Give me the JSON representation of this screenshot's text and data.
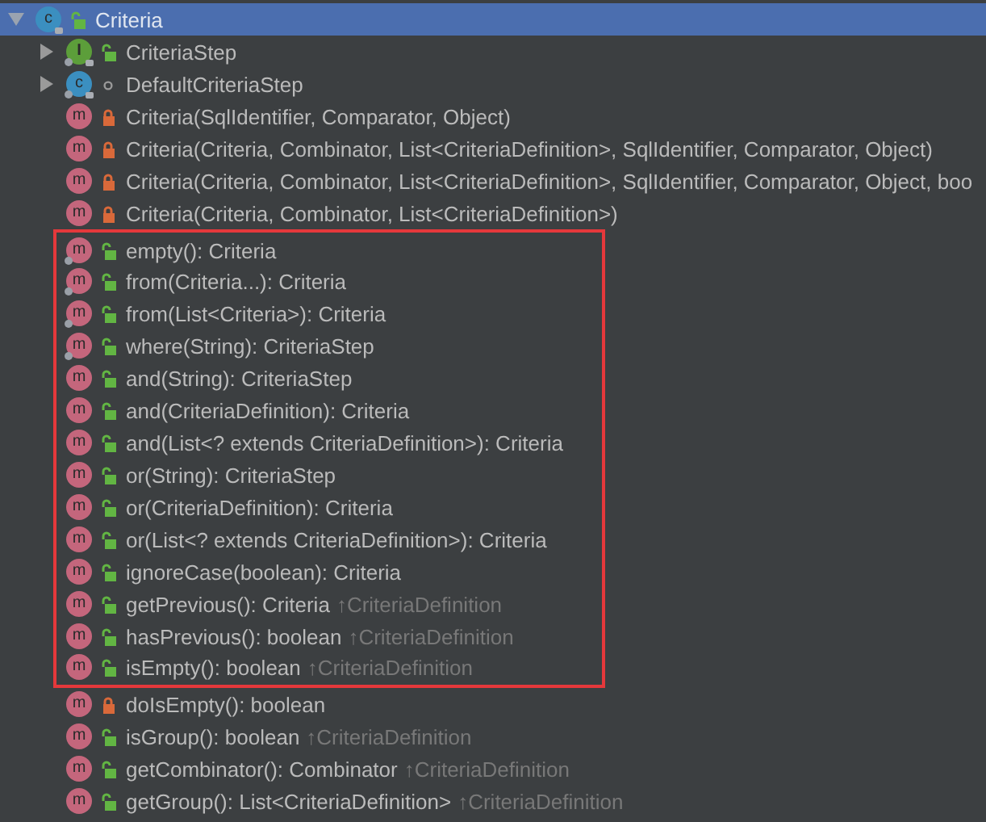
{
  "tree": {
    "label": "Criteria",
    "icon_letter": "c",
    "kind": "class",
    "private": false,
    "package": false,
    "static": false,
    "final": true,
    "expanded": true,
    "selected": true,
    "children": [
      {
        "label": "CriteriaStep",
        "icon_letter": "I",
        "kind": "interface",
        "private": false,
        "package": false,
        "static": true,
        "final": true,
        "expanded": false,
        "highlighted": false
      },
      {
        "label": "DefaultCriteriaStep",
        "icon_letter": "c",
        "kind": "class",
        "private": false,
        "package": true,
        "static": true,
        "final": true,
        "expanded": false,
        "highlighted": false
      },
      {
        "label": "Criteria(SqlIdentifier, Comparator, Object)",
        "icon_letter": "m",
        "kind": "method",
        "private": true,
        "package": false,
        "static": false,
        "highlighted": false
      },
      {
        "label": "Criteria(Criteria, Combinator, List<CriteriaDefinition>, SqlIdentifier, Comparator, Object)",
        "icon_letter": "m",
        "kind": "method",
        "private": true,
        "package": false,
        "static": false,
        "highlighted": false
      },
      {
        "label": "Criteria(Criteria, Combinator, List<CriteriaDefinition>, SqlIdentifier, Comparator, Object, boo",
        "icon_letter": "m",
        "kind": "method",
        "private": true,
        "package": false,
        "static": false,
        "highlighted": false
      },
      {
        "label": "Criteria(Criteria, Combinator, List<CriteriaDefinition>)",
        "icon_letter": "m",
        "kind": "method",
        "private": true,
        "package": false,
        "static": false,
        "highlighted": false
      },
      {
        "label": "empty(): Criteria",
        "icon_letter": "m",
        "kind": "method",
        "private": false,
        "package": false,
        "static": true,
        "highlighted": true
      },
      {
        "label": "from(Criteria...): Criteria",
        "icon_letter": "m",
        "kind": "method",
        "private": false,
        "package": false,
        "static": true,
        "highlighted": true
      },
      {
        "label": "from(List<Criteria>): Criteria",
        "icon_letter": "m",
        "kind": "method",
        "private": false,
        "package": false,
        "static": true,
        "highlighted": true
      },
      {
        "label": "where(String): CriteriaStep",
        "icon_letter": "m",
        "kind": "method",
        "private": false,
        "package": false,
        "static": true,
        "highlighted": true
      },
      {
        "label": "and(String): CriteriaStep",
        "icon_letter": "m",
        "kind": "method",
        "private": false,
        "package": false,
        "static": false,
        "highlighted": true
      },
      {
        "label": "and(CriteriaDefinition): Criteria",
        "icon_letter": "m",
        "kind": "method",
        "private": false,
        "package": false,
        "static": false,
        "highlighted": true
      },
      {
        "label": "and(List<? extends CriteriaDefinition>): Criteria",
        "icon_letter": "m",
        "kind": "method",
        "private": false,
        "package": false,
        "static": false,
        "highlighted": true
      },
      {
        "label": "or(String): CriteriaStep",
        "icon_letter": "m",
        "kind": "method",
        "private": false,
        "package": false,
        "static": false,
        "highlighted": true
      },
      {
        "label": "or(CriteriaDefinition): Criteria",
        "icon_letter": "m",
        "kind": "method",
        "private": false,
        "package": false,
        "static": false,
        "highlighted": true
      },
      {
        "label": "or(List<? extends CriteriaDefinition>): Criteria",
        "icon_letter": "m",
        "kind": "method",
        "private": false,
        "package": false,
        "static": false,
        "highlighted": true
      },
      {
        "label": "ignoreCase(boolean): Criteria",
        "icon_letter": "m",
        "kind": "method",
        "private": false,
        "package": false,
        "static": false,
        "highlighted": true
      },
      {
        "label": "getPrevious(): Criteria",
        "inherited": "↑CriteriaDefinition",
        "icon_letter": "m",
        "kind": "method",
        "private": false,
        "package": false,
        "static": false,
        "highlighted": true
      },
      {
        "label": "hasPrevious(): boolean",
        "inherited": "↑CriteriaDefinition",
        "icon_letter": "m",
        "kind": "method",
        "private": false,
        "package": false,
        "static": false,
        "highlighted": true
      },
      {
        "label": "isEmpty(): boolean",
        "inherited": "↑CriteriaDefinition",
        "icon_letter": "m",
        "kind": "method",
        "private": false,
        "package": false,
        "static": false,
        "highlighted": true
      },
      {
        "label": "doIsEmpty(): boolean",
        "icon_letter": "m",
        "kind": "method",
        "private": true,
        "package": false,
        "static": false,
        "highlighted": false
      },
      {
        "label": "isGroup(): boolean",
        "inherited": "↑CriteriaDefinition",
        "icon_letter": "m",
        "kind": "method",
        "private": false,
        "package": false,
        "static": false,
        "highlighted": false
      },
      {
        "label": "getCombinator(): Combinator",
        "inherited": "↑CriteriaDefinition",
        "icon_letter": "m",
        "kind": "method",
        "private": false,
        "package": false,
        "static": false,
        "highlighted": false
      },
      {
        "label": "getGroup(): List<CriteriaDefinition>",
        "inherited": "↑CriteriaDefinition",
        "icon_letter": "m",
        "kind": "method",
        "private": false,
        "package": false,
        "static": false,
        "highlighted": false
      }
    ]
  }
}
